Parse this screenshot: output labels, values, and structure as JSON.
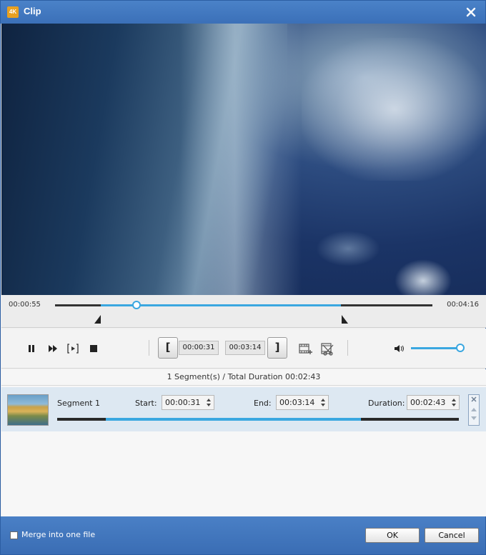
{
  "window": {
    "title": "Clip",
    "logo_text": "4K"
  },
  "timeline": {
    "current_time": "00:00:55",
    "total_time": "00:04:16",
    "playhead_fraction": 0.215,
    "selection_start_fraction": 0.121,
    "selection_end_fraction": 0.757
  },
  "controls": {
    "start_time": "00:00:31",
    "end_time": "00:03:14",
    "start_bracket": "[",
    "end_bracket": "]",
    "volume_fraction": 0.98
  },
  "summary": "1 Segment(s) / Total Duration 00:02:43",
  "segments": [
    {
      "name": "Segment 1",
      "start_label": "Start:",
      "start": "00:00:31",
      "end_label": "End:",
      "end": "00:03:14",
      "duration_label": "Duration:",
      "duration": "00:02:43",
      "range_start_fraction": 0.121,
      "range_end_fraction": 0.757
    }
  ],
  "footer": {
    "merge_label": "Merge into one file",
    "merge_checked": false,
    "ok_label": "OK",
    "cancel_label": "Cancel"
  },
  "colors": {
    "accent": "#3aa7e0",
    "title_bar": "#3b70b8"
  }
}
